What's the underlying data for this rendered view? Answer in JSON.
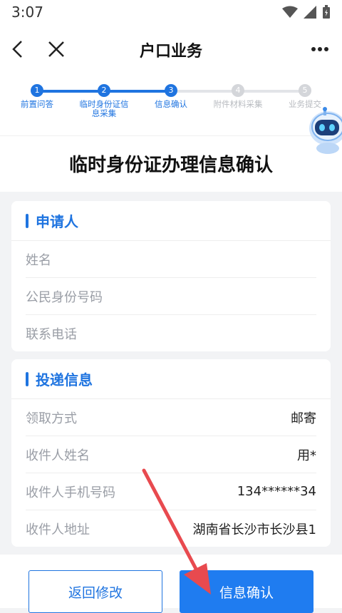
{
  "status_bar": {
    "time": "3:07"
  },
  "nav": {
    "title": "户口业务"
  },
  "steps": [
    {
      "number": "1",
      "label": "前置问答",
      "state": "done"
    },
    {
      "number": "2",
      "label": "临时身份证信息采集",
      "state": "done"
    },
    {
      "number": "3",
      "label": "信息确认",
      "state": "done"
    },
    {
      "number": "4",
      "label": "附件材料采集",
      "state": "todo"
    },
    {
      "number": "5",
      "label": "业务提交",
      "state": "todo"
    }
  ],
  "page_title": "临时身份证办理信息确认",
  "applicant": {
    "title": "申请人",
    "rows": [
      {
        "label": "姓名",
        "value": ""
      },
      {
        "label": "公民身份号码",
        "value": ""
      },
      {
        "label": "联系电话",
        "value": ""
      }
    ]
  },
  "delivery": {
    "title": "投递信息",
    "rows": [
      {
        "label": "领取方式",
        "value": "邮寄"
      },
      {
        "label": "收件人姓名",
        "value": "用*"
      },
      {
        "label": "收件人手机号码",
        "value": "134******34"
      },
      {
        "label": "收件人地址",
        "value": "湖南省长沙市长沙县1"
      }
    ]
  },
  "buttons": {
    "back_label": "返回修改",
    "confirm_label": "信息确认"
  },
  "colors": {
    "accent": "#1f74e0",
    "annotation_arrow": "#e84a4f"
  },
  "icons": [
    "back-arrow-icon",
    "close-icon",
    "more-icon",
    "wifi-icon",
    "signal-icon",
    "battery-icon",
    "robot-assistant-icon"
  ]
}
